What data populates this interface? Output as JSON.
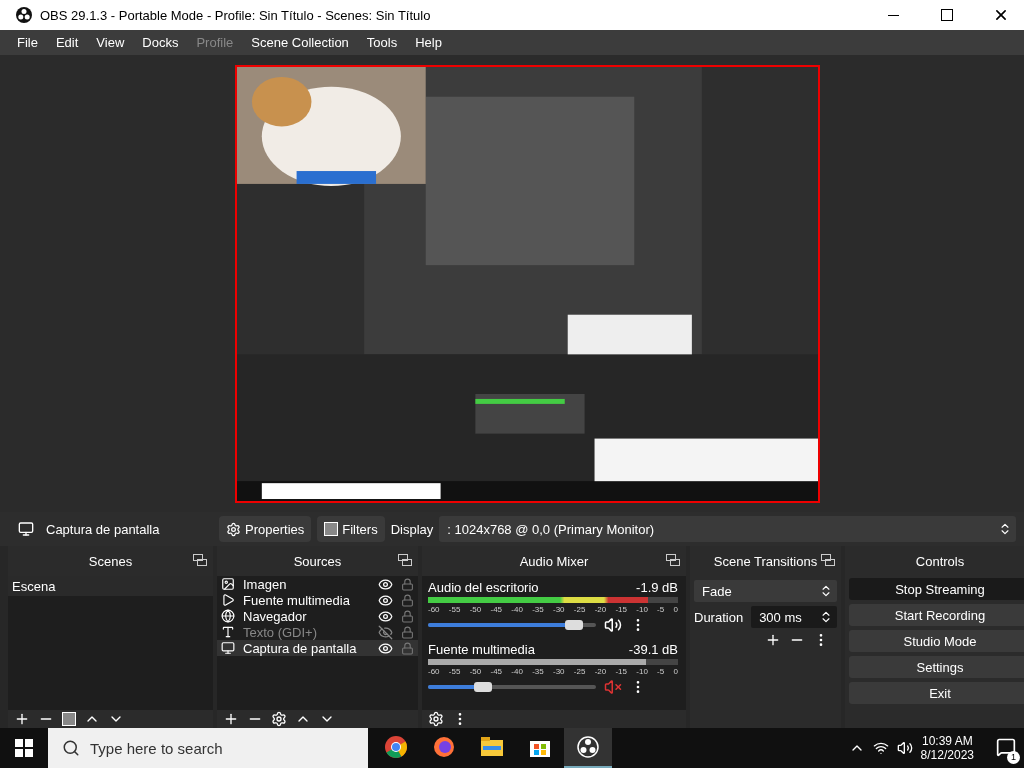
{
  "window": {
    "title": "OBS 29.1.3 - Portable Mode - Profile: Sin Título - Scenes: Sin Título"
  },
  "menu": [
    {
      "label": "File",
      "disabled": false
    },
    {
      "label": "Edit",
      "disabled": false
    },
    {
      "label": "View",
      "disabled": false
    },
    {
      "label": "Docks",
      "disabled": false
    },
    {
      "label": "Profile",
      "disabled": true
    },
    {
      "label": "Scene Collection",
      "disabled": false
    },
    {
      "label": "Tools",
      "disabled": false
    },
    {
      "label": "Help",
      "disabled": false
    }
  ],
  "source_bar": {
    "source": "Captura de pantalla",
    "properties": "Properties",
    "filters": "Filters",
    "display_label": "Display",
    "display_value": ": 1024x768 @ 0,0 (Primary Monitor)"
  },
  "scenes": {
    "title": "Scenes",
    "items": [
      {
        "name": "Escena",
        "selected": true
      }
    ]
  },
  "sources": {
    "title": "Sources",
    "items": [
      {
        "name": "Imagen",
        "visible": true,
        "selected": false
      },
      {
        "name": "Fuente multimedia",
        "kind": "media",
        "visible": true,
        "selected": false
      },
      {
        "name": "Navegador",
        "kind": "browser",
        "visible": true,
        "selected": false
      },
      {
        "name": "Texto (GDI+)",
        "kind": "text",
        "visible": false,
        "selected": false
      },
      {
        "name": "Captura de pantalla",
        "kind": "display",
        "visible": true,
        "selected": true
      }
    ]
  },
  "audio_mixer": {
    "title": "Audio Mixer",
    "channels": [
      {
        "name": "Audio del escritorio",
        "reading": "-1.9 dB",
        "meter": {
          "level": 0.88
        },
        "muted": false,
        "volume": {
          "level": 0.87
        },
        "scale": [
          "-60",
          "-55",
          "-50",
          "-45",
          "-40",
          "-35",
          "-30",
          "-25",
          "-20",
          "-15",
          "-10",
          "-5",
          "0"
        ]
      },
      {
        "name": "Fuente multimedia",
        "reading": "-39.1 dB",
        "meter": {
          "level": 0.87
        },
        "muted": true,
        "volume": {
          "level": 0.33
        },
        "scale": [
          "-60",
          "-55",
          "-50",
          "-45",
          "-40",
          "-35",
          "-30",
          "-25",
          "-20",
          "-15",
          "-10",
          "-5",
          "0"
        ]
      }
    ]
  },
  "scene_transitions": {
    "title": "Scene Transitions",
    "transition": "Fade",
    "duration_label": "Duration",
    "duration": "300 ms"
  },
  "controls": {
    "title": "Controls",
    "buttons": [
      {
        "label": "Stop Streaming",
        "active": true
      },
      {
        "label": "Start Recording",
        "active": false
      },
      {
        "label": "Studio Mode",
        "active": false
      },
      {
        "label": "Settings",
        "active": false
      },
      {
        "label": "Exit",
        "active": false
      }
    ]
  },
  "taskbar": {
    "search_placeholder": "Type here to search",
    "apps": [
      {
        "kind": "chrome",
        "active": false
      },
      {
        "kind": "firefox",
        "active": false
      },
      {
        "kind": "explorer",
        "active": false
      },
      {
        "kind": "store",
        "active": false
      },
      {
        "kind": "obs",
        "active": true
      }
    ],
    "time": "10:39 AM",
    "date": "8/12/2023",
    "notifications": "1"
  }
}
